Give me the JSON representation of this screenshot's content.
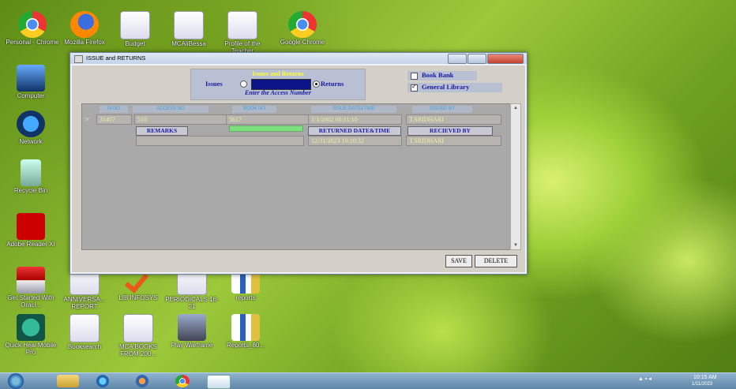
{
  "desktop": {
    "icons": [
      {
        "label": "Personal - Chrome",
        "icon": "chrome-icon"
      },
      {
        "label": "Mozilla Firefox",
        "icon": "firefox-icon"
      },
      {
        "label": "Budget",
        "icon": "document-icon"
      },
      {
        "label": "MCAliBessa",
        "icon": "document-icon"
      },
      {
        "label": "Profile of the Teacher",
        "icon": "document-icon"
      },
      {
        "label": "Google Chrome",
        "icon": "chrome-icon"
      },
      {
        "label": "Computer",
        "icon": "computer-icon"
      },
      {
        "label": "Network",
        "icon": "network-icon"
      },
      {
        "label": "Recycle Bin",
        "icon": "recycle-bin-icon"
      },
      {
        "label": "Adobe Reader XI",
        "icon": "pdf-icon"
      },
      {
        "label": "Get Started With Oracl...",
        "icon": "database-icon"
      },
      {
        "label": "ANNIVERSA... REPORT",
        "icon": "document-icon"
      },
      {
        "label": "LIB INFOSYS",
        "icon": "checkmark-icon"
      },
      {
        "label": "PERIODICALS 16-21",
        "icon": "document-icon"
      },
      {
        "label": "reports",
        "icon": "book-icon"
      },
      {
        "label": "Quick Heal Mobile Pro",
        "icon": "globe-icon"
      },
      {
        "label": "Booksearch",
        "icon": "document-icon"
      },
      {
        "label": "MCA BOOKS FROM 200...",
        "icon": "document-icon"
      },
      {
        "label": "Play Warframe",
        "icon": "game-icon"
      },
      {
        "label": "Reports_80...",
        "icon": "book-icon"
      }
    ]
  },
  "window": {
    "title": "ISSUE and RETURNS",
    "mode_box_title": "Issues and Returns",
    "issues_label": "Issues",
    "returns_label": "Returns",
    "enter_prompt": "Enter the Access Number",
    "access_number_value": "",
    "issues_selected": false,
    "returns_selected": true,
    "book_bank_label": "Book Bank",
    "general_library_label": "General Library",
    "book_bank_checked": false,
    "general_library_checked": true
  },
  "grid": {
    "headers": [
      "M.NO",
      "ACCESS NO",
      "BOOK NO",
      "ISSUE DATE&TIME",
      "ISSUED BY"
    ],
    "row": {
      "m_no": "31457",
      "access_no": "510",
      "book_no": "5617",
      "issue_datetime": "1/1/2002 00:11:10",
      "issued_by": "T.SRIDHARI"
    },
    "remarks_label": "REMARKS",
    "returned_label": "RETURNED DATE&TIME",
    "received_label": "RECIEVED BY",
    "returned_value": "12/31/2023 10:10:32",
    "received_value": "T.SRIDHARI",
    "remarks_value": ""
  },
  "buttons": {
    "save": "SAVE",
    "delete": "DELETE"
  },
  "tray": {
    "time": "10:15 AM",
    "date": "1/11/2023"
  }
}
